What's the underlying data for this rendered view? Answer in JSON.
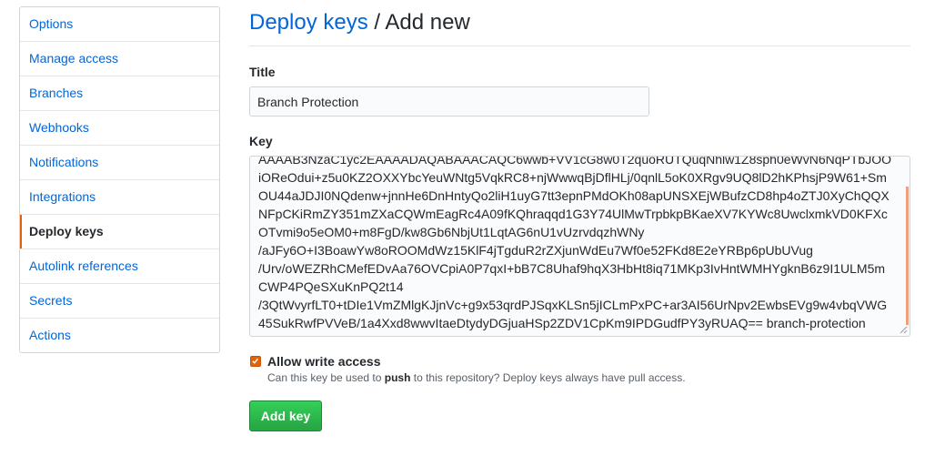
{
  "sidebar": {
    "items": [
      {
        "label": "Options",
        "selected": false
      },
      {
        "label": "Manage access",
        "selected": false
      },
      {
        "label": "Branches",
        "selected": false
      },
      {
        "label": "Webhooks",
        "selected": false
      },
      {
        "label": "Notifications",
        "selected": false
      },
      {
        "label": "Integrations",
        "selected": false
      },
      {
        "label": "Deploy keys",
        "selected": true
      },
      {
        "label": "Autolink references",
        "selected": false
      },
      {
        "label": "Secrets",
        "selected": false
      },
      {
        "label": "Actions",
        "selected": false
      }
    ]
  },
  "header": {
    "breadcrumb_link": "Deploy keys",
    "separator": " / ",
    "current": "Add new"
  },
  "form": {
    "title_label": "Title",
    "title_value": "Branch Protection",
    "key_label": "Key",
    "key_lines": [
      "AAAAB3NzaC1yc2EAAAADAQABAAACAQC6wwb+VV1cG8w0T2quoRUTQuqNhlw1Z8sph0eWvN6NqPTbJOO",
      "iOReOdui+z5u0KZ2OXXYbcYeuWNtg5VqkRC8+njWwwqBjDflHLj/0qnlL5oK0XRgv9UQ8lD2hKPhsjP9W61+Sm",
      "OU44aJDJI0NQdenw+jnnHe6DnHntyQo2liH1uyG7tt3epnPMdOKh08apUNSXEjWBufzCD8hp4oZTJ0XyChQQX",
      "NFpCKiRmZY351mZXaCQWmEagRc4A09fKQhraqqd1G3Y74UlMwTrpbkpBKaeXV7KYWc8UwclxmkVD0KFXc",
      "OTvmi9o5eOM0+m8FgD/kw8Gb6NbjUt1LqtAG6nU1vUzrvdqzhWNy",
      "/aJFy6O+I3BoawYw8oROOMdWz15KlF4jTgduR2rZXjunWdEu7Wf0e52FKd8E2eYRBp6pUbUVug",
      "/Urv/oWEZRhCMefEDvAa76OVCpiA0P7qxI+bB7C8Uhaf9hqX3HbHt8iq71MKp3IvHntWMHYgknB6z9I1ULM5m",
      "CWP4PQeSXuKnPQ2t14",
      "/3QtWvyrfLT0+tDIe1VmZMlgKJjnVc+g9x53qrdPJSqxKLSn5jICLmPxPC+ar3AI56UrNpv2EwbsEVg9w4vbqVWG",
      "45SukRwfPVVeB/1a4Xxd8wwvItaeDtydyDGjuaHSp2ZDV1CpKm9IPDGudfPY3yRUAQ== branch-protection"
    ],
    "allow_write_label": "Allow write access",
    "allow_write_checked": true,
    "note_before": "Can this key be used to ",
    "note_bold": "push",
    "note_after": " to this repository? Deploy keys always have pull access.",
    "submit_label": "Add key"
  },
  "colors": {
    "link": "#0366d6",
    "accent": "#e36209",
    "button_green": "#28a745"
  }
}
